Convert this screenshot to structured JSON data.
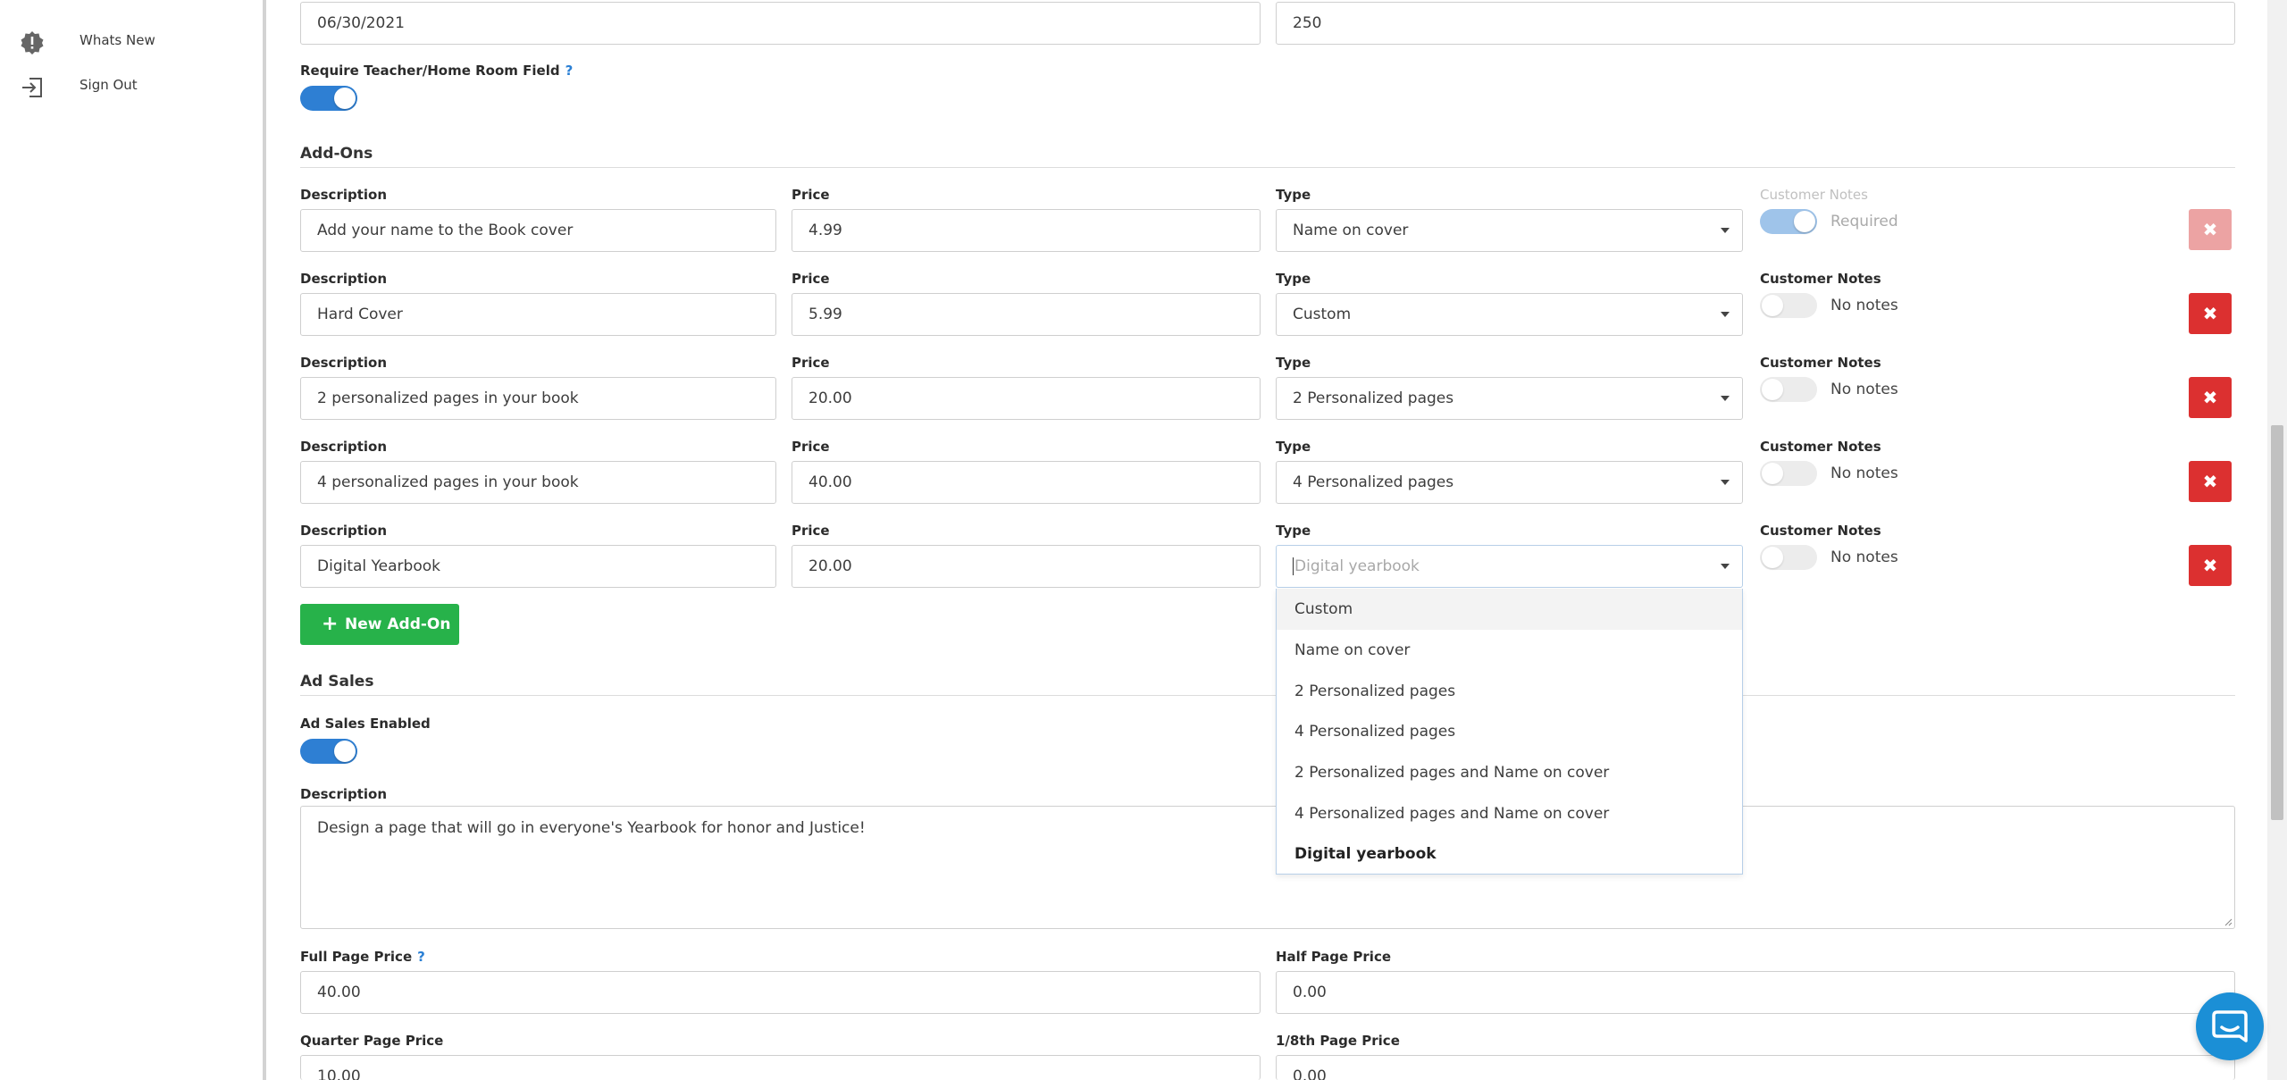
{
  "sidebar": {
    "items": [
      {
        "label": "Whats New",
        "icon": "alert-badge-icon"
      },
      {
        "label": "Sign Out",
        "icon": "sign-out-icon"
      }
    ]
  },
  "top_fields": {
    "date_value": "06/30/2021",
    "count_value": "250"
  },
  "teacher_field": {
    "label": "Require Teacher/Home Room Field",
    "help": "?",
    "enabled": true
  },
  "addons": {
    "title": "Add-Ons",
    "labels": {
      "description": "Description",
      "price": "Price",
      "type": "Type",
      "customer_notes": "Customer Notes"
    },
    "rows": [
      {
        "description": "Add your name to the Book cover",
        "price": "4.99",
        "type": "Name on cover",
        "notes_text": "Required",
        "notes_on": true,
        "disabled": true
      },
      {
        "description": "Hard Cover",
        "price": "5.99",
        "type": "Custom",
        "notes_text": "No notes",
        "notes_on": false,
        "disabled": false
      },
      {
        "description": "2 personalized pages in your book",
        "price": "20.00",
        "type": "2 Personalized pages",
        "notes_text": "No notes",
        "notes_on": false,
        "disabled": false
      },
      {
        "description": "4 personalized pages in your book",
        "price": "40.00",
        "type": "4 Personalized pages",
        "notes_text": "No notes",
        "notes_on": false,
        "disabled": false
      },
      {
        "description": "Digital Yearbook",
        "price": "20.00",
        "type_placeholder": "Digital yearbook",
        "notes_text": "No notes",
        "notes_on": false,
        "disabled": false
      }
    ],
    "delete_symbol": "✖",
    "new_button": {
      "plus": "+",
      "label": "New Add-On"
    }
  },
  "type_dropdown": {
    "options": [
      "Custom",
      "Name on cover",
      "2 Personalized pages",
      "4 Personalized pages",
      "2 Personalized pages and Name on cover",
      "4 Personalized pages and Name on cover",
      "Digital yearbook"
    ],
    "hovered": "Custom",
    "selected": "Digital yearbook"
  },
  "ad_sales": {
    "title": "Ad Sales",
    "enabled_label": "Ad Sales Enabled",
    "enabled": true,
    "description_label": "Description",
    "description": "Design a page that will go in everyone's Yearbook for honor and Justice!",
    "full_page_price_label": "Full Page Price",
    "full_page_help": "?",
    "full_page_price": "40.00",
    "half_page_price_label": "Half Page Price",
    "half_page_price": "0.00",
    "quarter_page_price_label": "Quarter Page Price",
    "quarter_page_price": "10.00",
    "eighth_page_price_label": "1/8th Page Price",
    "eighth_page_price": "0.00"
  },
  "colors": {
    "primary_blue": "#2e7fd3",
    "danger_red": "#dc3030",
    "success_green": "#27b24a",
    "chat_blue": "#1b8fd6"
  }
}
